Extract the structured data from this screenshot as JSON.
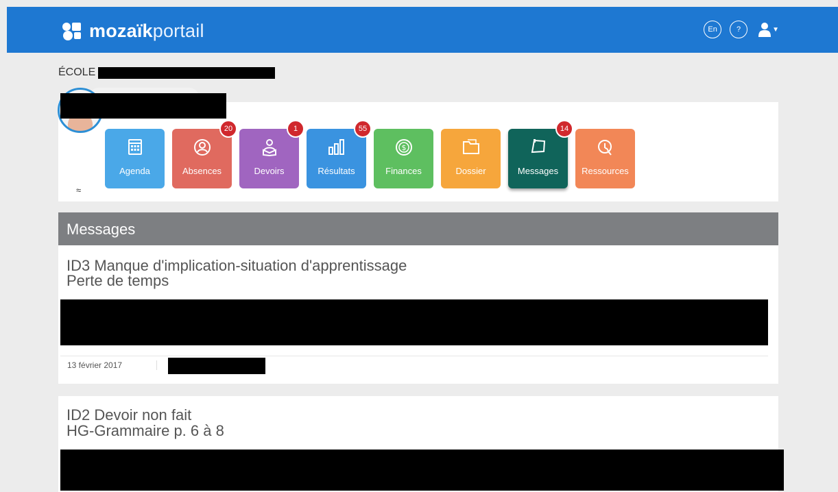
{
  "header": {
    "logo_bold": "mozaïk",
    "logo_light": "portail",
    "lang_label": "En",
    "help_label": "?"
  },
  "school": {
    "label": "ÉCOLE"
  },
  "nav": {
    "tiles": [
      {
        "label": "Agenda",
        "color": "#4aa8e8",
        "icon": "calendar-icon",
        "badge": ""
      },
      {
        "label": "Absences",
        "color": "#e06a5f",
        "icon": "person-circle-icon",
        "badge": "20"
      },
      {
        "label": "Devoirs",
        "color": "#a065c0",
        "icon": "reader-icon",
        "badge": "1"
      },
      {
        "label": "Résultats",
        "color": "#3a93e0",
        "icon": "bar-chart-icon",
        "badge": "55"
      },
      {
        "label": "Finances",
        "color": "#5ebf60",
        "icon": "dollar-icon",
        "badge": ""
      },
      {
        "label": "Dossier",
        "color": "#f6a63c",
        "icon": "folder-icon",
        "badge": ""
      },
      {
        "label": "Messages",
        "color": "#10645a",
        "icon": "message-icon",
        "badge": "14"
      },
      {
        "label": "Ressources",
        "color": "#f28757",
        "icon": "resource-icon",
        "badge": ""
      }
    ]
  },
  "section": {
    "title": "Messages"
  },
  "messages": [
    {
      "title": "ID3 Manque d'implication-situation d'apprentissage",
      "subtitle": "Perte de temps",
      "date": "13 février 2017"
    },
    {
      "title": "ID2 Devoir non fait",
      "subtitle": "HG-Grammaire p. 6 à 8"
    }
  ],
  "colors": {
    "brand": "#1e78d2",
    "badge": "#d0282d",
    "section_header": "#7d7f82"
  }
}
